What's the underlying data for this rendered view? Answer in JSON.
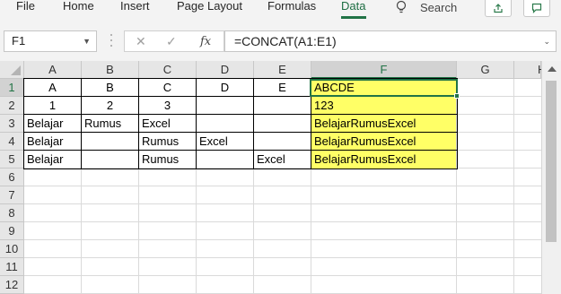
{
  "ribbon": {
    "tabs": [
      {
        "label": "File",
        "active": false
      },
      {
        "label": "Home",
        "active": false
      },
      {
        "label": "Insert",
        "active": false
      },
      {
        "label": "Page Layout",
        "active": false
      },
      {
        "label": "Formulas",
        "active": false
      },
      {
        "label": "Data",
        "active": true
      },
      {
        "label": "Search",
        "active": false
      }
    ],
    "share_icon": "share-icon",
    "comments_icon": "comment-icon",
    "accent_color": "#217346"
  },
  "formula_bar": {
    "name_box": "F1",
    "cancel_icon": "✕",
    "enter_icon": "✓",
    "fx_label": "fx",
    "formula": "=CONCAT(A1:E1)"
  },
  "grid": {
    "columns": [
      "A",
      "B",
      "C",
      "D",
      "E",
      "F",
      "G",
      "H"
    ],
    "rows": [
      "1",
      "2",
      "3",
      "4",
      "5",
      "6",
      "7",
      "8",
      "9",
      "10",
      "11",
      "12"
    ],
    "selected_cell": "F1",
    "highlight_color": "#ffff66",
    "cells": {
      "A1": "A",
      "B1": "B",
      "C1": "C",
      "D1": "D",
      "E1": "E",
      "F1": "ABCDE",
      "A2": "1",
      "B2": "2",
      "C2": "3",
      "F2": "123",
      "A3": "Belajar",
      "B3": "Rumus",
      "C3": "Excel",
      "F3": "BelajarRumusExcel",
      "A4": "Belajar",
      "C4": "Rumus",
      "D4": "Excel",
      "F4": "BelajarRumusExcel",
      "A5": "Belajar",
      "C5": "Rumus",
      "E5": "Excel",
      "F5": "BelajarRumusExcel"
    }
  }
}
